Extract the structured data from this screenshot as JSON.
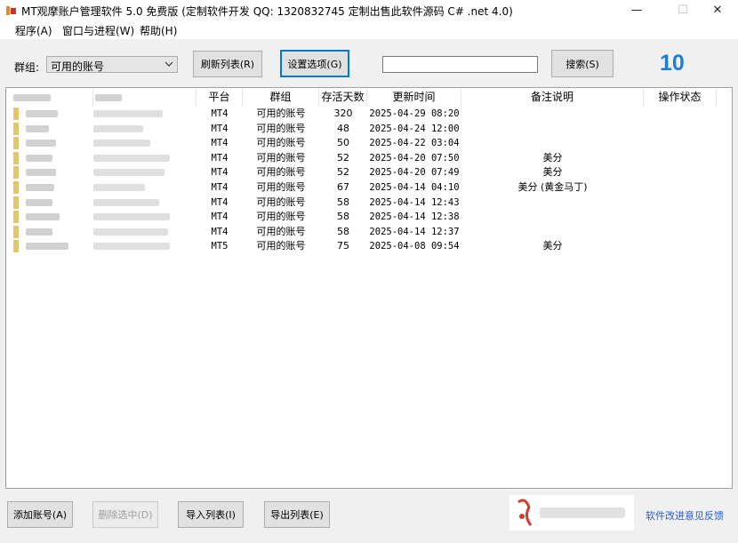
{
  "window": {
    "title": "MT观摩账户管理软件 5.0 免费版 (定制软件开发 QQ: 1320832745   定制出售此软件源码 C# .net 4.0)",
    "minimize": "—",
    "maximize": "☐",
    "close": "✕"
  },
  "menu": [
    {
      "label": "程序(A)"
    },
    {
      "label": "窗口与进程(W)"
    },
    {
      "label": "帮助(H)"
    }
  ],
  "toolbar": {
    "group_label": "群组:",
    "group_selected": "可用的账号",
    "refresh_label": "刷新列表(R)",
    "settings_label": "设置选项(G)",
    "search_value": "",
    "search_label": "搜索(S)",
    "count": "10"
  },
  "table": {
    "headers": [
      "平台",
      "群组",
      "存活天数",
      "更新时间",
      "备注说明",
      "操作状态"
    ],
    "rows": [
      {
        "platform": "MT4",
        "group": "可用的账号",
        "days": "320",
        "time": "2025-04-29 08:20",
        "note": ""
      },
      {
        "platform": "MT4",
        "group": "可用的账号",
        "days": "48",
        "time": "2025-04-24 12:00",
        "note": ""
      },
      {
        "platform": "MT4",
        "group": "可用的账号",
        "days": "50",
        "time": "2025-04-22 03:04",
        "note": ""
      },
      {
        "platform": "MT4",
        "group": "可用的账号",
        "days": "52",
        "time": "2025-04-20 07:50",
        "note": "美分"
      },
      {
        "platform": "MT4",
        "group": "可用的账号",
        "days": "52",
        "time": "2025-04-20 07:49",
        "note": "美分"
      },
      {
        "platform": "MT4",
        "group": "可用的账号",
        "days": "67",
        "time": "2025-04-14 04:10",
        "note": "美分 (黄金马丁)"
      },
      {
        "platform": "MT4",
        "group": "可用的账号",
        "days": "58",
        "time": "2025-04-14 12:43",
        "note": ""
      },
      {
        "platform": "MT4",
        "group": "可用的账号",
        "days": "58",
        "time": "2025-04-14 12:38",
        "note": ""
      },
      {
        "platform": "MT4",
        "group": "可用的账号",
        "days": "58",
        "time": "2025-04-14 12:37",
        "note": ""
      },
      {
        "platform": "MT5",
        "group": "可用的账号",
        "days": "75",
        "time": "2025-04-08 09:54",
        "note": "美分"
      }
    ]
  },
  "bottom": {
    "add_label": "添加账号(A)",
    "delete_label": "删除选中(D)",
    "import_label": "导入列表(I)",
    "export_label": "导出列表(E)",
    "feedback_label": "软件改进意见反馈"
  },
  "colors": {
    "accent": "#0078d7",
    "count": "#1b7ed8",
    "link": "#1f5ccf"
  }
}
